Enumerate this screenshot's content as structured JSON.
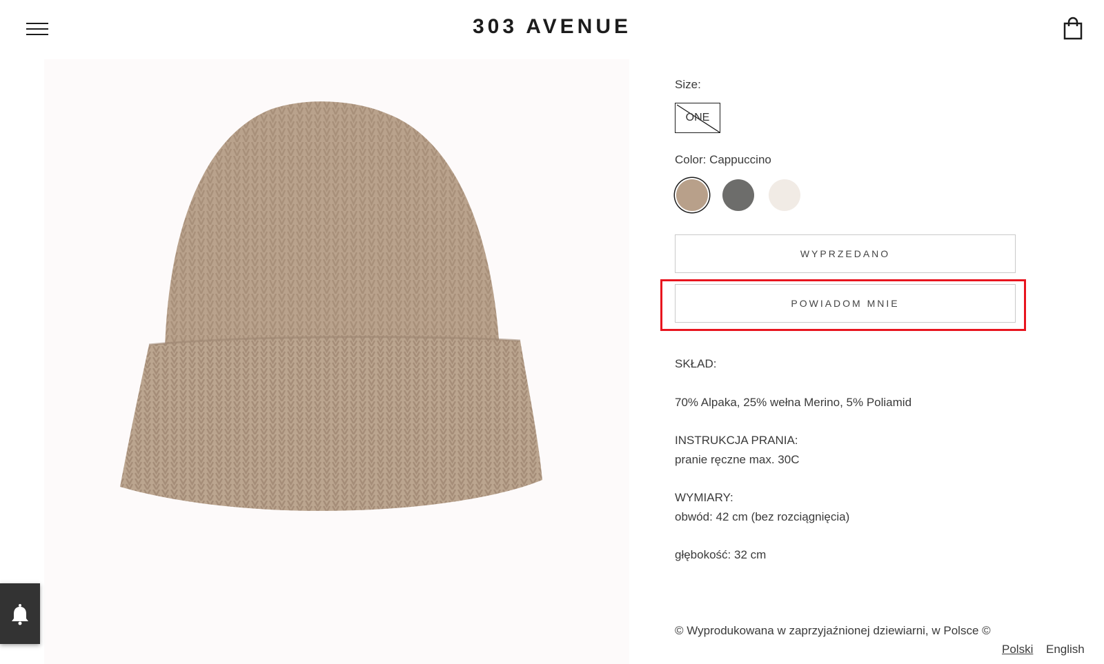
{
  "header": {
    "logo": "303 AVENUE",
    "menu_icon": "hamburger-menu-icon",
    "cart_icon": "shopping-bag-icon"
  },
  "product": {
    "image": "beige ribbed knit beanie",
    "size_label": "Size:",
    "size_option": "ONE",
    "size_unavailable": true,
    "color_label": "Color: Cappuccino",
    "colors": [
      {
        "name": "Cappuccino",
        "hex": "#b8a08a",
        "selected": true
      },
      {
        "name": "grey",
        "hex": "#6d6d6b",
        "selected": false
      },
      {
        "name": "cream",
        "hex": "#f1ebe5",
        "selected": false
      }
    ],
    "sold_out_button": "WYPRZEDANO",
    "notify_button": "POWIADOM MNIE"
  },
  "description": {
    "composition_label": "SKŁAD:",
    "composition": "70% Alpaka, 25% wełna Merino, 5% Poliamid",
    "washing_label": "INSTRUKCJA PRANIA:",
    "washing": "pranie ręczne max. 30C",
    "dimensions_label": "WYMIARY:",
    "circumference": "obwód: 42 cm (bez rozciągnięcia)",
    "depth": "głębokość: 32 cm",
    "made_in": "© Wyprodukowana w zaprzyjaźnionej dziewiarni, w Polsce ©"
  },
  "languages": [
    "Polski",
    "English"
  ],
  "notification_widget": {
    "icon": "bell-icon"
  },
  "colors": {
    "highlight": "#e8141e",
    "text": "#3a3a3a",
    "widget_bg": "#333333"
  }
}
